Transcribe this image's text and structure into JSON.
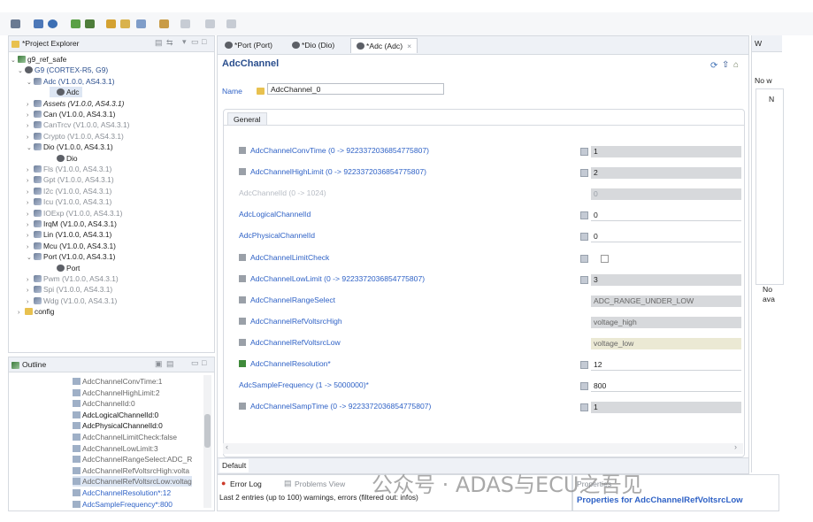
{
  "project_explorer": {
    "title": "*Project Explorer",
    "items": [
      {
        "text": "g9_ref_safe"
      },
      {
        "text": "G9 (CORTEX-R5, G9)"
      },
      {
        "text": "Adc (V1.0.0, AS4.3.1)"
      },
      {
        "text": "Adc"
      },
      {
        "text": "Assets (V1.0.0, AS4.3.1)"
      },
      {
        "text": "Can (V1.0.0, AS4.3.1)"
      },
      {
        "text": "CanTrcv (V1.0.0, AS4.3.1)"
      },
      {
        "text": "Crypto (V1.0.0, AS4.3.1)"
      },
      {
        "text": "Dio (V1.0.0, AS4.3.1)"
      },
      {
        "text": "Dio"
      },
      {
        "text": "Fls (V1.0.0, AS4.3.1)"
      },
      {
        "text": "Gpt (V1.0.0, AS4.3.1)"
      },
      {
        "text": "I2c (V1.0.0, AS4.3.1)"
      },
      {
        "text": "Icu (V1.0.0, AS4.3.1)"
      },
      {
        "text": "IOExp (V1.0.0, AS4.3.1)"
      },
      {
        "text": "IrqM (V1.0.0, AS4.3.1)"
      },
      {
        "text": "Lin (V1.0.0, AS4.3.1)"
      },
      {
        "text": "Mcu (V1.0.0, AS4.3.1)"
      },
      {
        "text": "Port (V1.0.0, AS4.3.1)"
      },
      {
        "text": "Port"
      },
      {
        "text": "Pwm (V1.0.0, AS4.3.1)"
      },
      {
        "text": "Spi (V1.0.0, AS4.3.1)"
      },
      {
        "text": "Wdg (V1.0.0, AS4.3.1)"
      },
      {
        "text": "config"
      }
    ]
  },
  "outline": {
    "title": "Outline",
    "items": [
      "AdcChannelConvTime:1",
      "AdcChannelHighLimit:2",
      "AdcChannelId:0",
      "AdcLogicalChannelId:0",
      "AdcPhysicalChannelId:0",
      "AdcChannelLimitCheck:false",
      "AdcChannelLowLimit:3",
      "AdcChannelRangeSelect:ADC_R",
      "AdcChannelRefVoltsrcHigh:volta",
      "AdcChannelRefVoltsrcLow:voltag",
      "AdcChannelResolution*:12",
      "AdcSampleFrequency*:800"
    ]
  },
  "editor": {
    "tabs": [
      "*Port (Port)",
      "*Dio (Dio)",
      "*Adc (Adc)"
    ],
    "title": "AdcChannel",
    "name_label": "Name",
    "name_value": "AdcChannel_0",
    "section": "General",
    "default_tab": "Default",
    "fields": [
      {
        "label": "AdcChannelConvTime (0 -> 9223372036854775807)",
        "value": "1"
      },
      {
        "label": "AdcChannelHighLimit (0 -> 9223372036854775807)",
        "value": "2"
      },
      {
        "label": "AdcChannelId (0 -> 1024)",
        "value": "0"
      },
      {
        "label": "AdcLogicalChannelId",
        "value": "0"
      },
      {
        "label": "AdcPhysicalChannelId",
        "value": "0"
      },
      {
        "label": "AdcChannelLimitCheck",
        "value": ""
      },
      {
        "label": "AdcChannelLowLimit (0 -> 9223372036854775807)",
        "value": "3"
      },
      {
        "label": "AdcChannelRangeSelect",
        "value": "ADC_RANGE_UNDER_LOW"
      },
      {
        "label": "AdcChannelRefVoltsrcHigh",
        "value": "voltage_high"
      },
      {
        "label": "AdcChannelRefVoltsrcLow",
        "value": "voltage_low"
      },
      {
        "label": "AdcChannelResolution*",
        "value": "12"
      },
      {
        "label": "AdcSampleFrequency (1 -> 5000000)*",
        "value": "800"
      },
      {
        "label": "AdcChannelSampTime (0 -> 9223372036854775807)",
        "value": "1"
      }
    ]
  },
  "bottom": {
    "error_tab": "Error Log",
    "problems_tab": "Problems View",
    "status": "Last 2 entries (up to 100) warnings, errors (filtered out: infos)",
    "properties_tab": "Properties",
    "properties_title": "Properties for AdcChannelRefVoltsrcLow"
  },
  "right_panel": {
    "tab": "W",
    "text1": "No w",
    "text2": "N",
    "text3": "No",
    "text4": "ava"
  },
  "watermark": "公众号 · ADAS与ECU之吾见"
}
